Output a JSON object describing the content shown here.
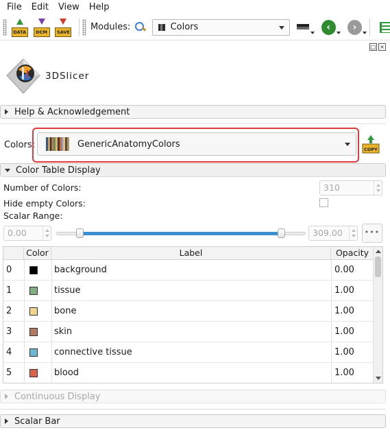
{
  "menu": [
    "File",
    "Edit",
    "View",
    "Help"
  ],
  "toolbar": {
    "data_label": "DATA",
    "dcm_label": "DCM",
    "save_label": "SAVE",
    "modules_label": "Modules:",
    "module_selected": "Colors"
  },
  "logo": {
    "text": "3DSlicer"
  },
  "sections": {
    "help": "Help & Acknowledgement",
    "color_table": "Color Table Display",
    "continuous": "Continuous Display",
    "scalar_bar": "Scalar Bar"
  },
  "colors_selector": {
    "label": "Colors:",
    "value": "GenericAnatomyColors",
    "copy_label": "COPY"
  },
  "form": {
    "num_colors_label": "Number of Colors:",
    "num_colors_value": "310",
    "hide_empty_label": "Hide empty Colors:",
    "scalar_range_label": "Scalar Range:",
    "range_min": "0.00",
    "range_max": "309.00",
    "more_label": "•••"
  },
  "table": {
    "headers": [
      "",
      "Color",
      "Label",
      "Opacity"
    ],
    "rows": [
      {
        "index": "0",
        "color": "#000000",
        "label": "background",
        "opacity": "0.00"
      },
      {
        "index": "1",
        "color": "#80ae80",
        "label": "tissue",
        "opacity": "1.00"
      },
      {
        "index": "2",
        "color": "#f1d691",
        "label": "bone",
        "opacity": "1.00"
      },
      {
        "index": "3",
        "color": "#b17a65",
        "label": "skin",
        "opacity": "1.00"
      },
      {
        "index": "4",
        "color": "#6fb8d2",
        "label": "connective tissue",
        "opacity": "1.00"
      },
      {
        "index": "5",
        "color": "#d8654f",
        "label": "blood",
        "opacity": "1.00"
      }
    ]
  },
  "colors": {
    "highlight": "#e23a3a",
    "slider_fill": "#3c8fd0"
  }
}
